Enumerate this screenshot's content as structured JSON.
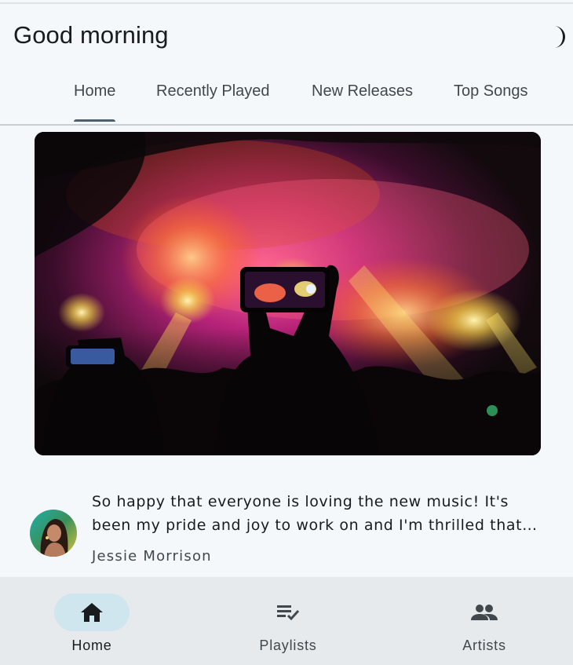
{
  "header": {
    "greeting": "Good morning",
    "theme_toggle_icon": "dark-mode-moon-icon"
  },
  "tabs": [
    {
      "label": "Home",
      "active": true
    },
    {
      "label": "Recently Played",
      "active": false
    },
    {
      "label": "New Releases",
      "active": false
    },
    {
      "label": "Top Songs",
      "active": false
    }
  ],
  "hero": {
    "image": "concert-crowd-phone-photo",
    "description_icon": "concert-image"
  },
  "post": {
    "text": "So happy that everyone is loving the new music! It's been my pride and joy to work on and I'm thrilled that you all enjoy it.",
    "author": "Jessie Morrison",
    "avatar_icon": "artist-avatar"
  },
  "bottom_nav": [
    {
      "label": "Home",
      "icon": "home-icon",
      "active": true
    },
    {
      "label": "Playlists",
      "icon": "playlist-check-icon",
      "active": false
    },
    {
      "label": "Artists",
      "icon": "people-icon",
      "active": false
    }
  ],
  "colors": {
    "background": "#f4f8fb",
    "nav_background": "#e6eaed",
    "active_pill": "#cfe6ef",
    "tab_indicator": "#4f5f6b",
    "text_primary": "#191c1e",
    "text_secondary": "#41484d"
  }
}
